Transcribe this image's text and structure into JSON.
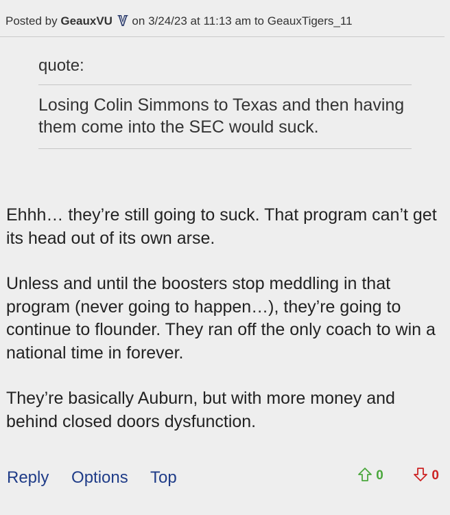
{
  "header": {
    "posted_by_label": "Posted by",
    "author": "GeauxVU",
    "on_label": "on",
    "date": "3/24/23",
    "at_label": "at",
    "time": "11:13 am",
    "to_label": "to",
    "recipient": "GeauxTigers_11",
    "badge_icon": "vanderbilt-v-icon"
  },
  "quote": {
    "label": "quote:",
    "text": "Losing Colin Simmons to Texas and then having them come into the SEC would suck."
  },
  "body": {
    "paragraphs": [
      "Ehhh… they’re still going to suck. That program can’t get its head out of its own arse.",
      "Unless and until the boosters stop meddling in that program (never going to happen…), they’re going to continue to flounder. They ran off the only coach to win a national time in forever.",
      "They’re basically Auburn, but with more money and behind closed doors dysfunction."
    ]
  },
  "actions": {
    "reply": "Reply",
    "options": "Options",
    "top": "Top"
  },
  "votes": {
    "up_count": "0",
    "down_count": "0",
    "up_icon": "arrow-up-outline-icon",
    "down_icon": "arrow-down-outline-icon",
    "up_color": "#4aa73c",
    "down_color": "#cc2222"
  },
  "colors": {
    "background": "#eeeeee",
    "link": "#1f3c88",
    "badge": "#2a3a6a"
  }
}
